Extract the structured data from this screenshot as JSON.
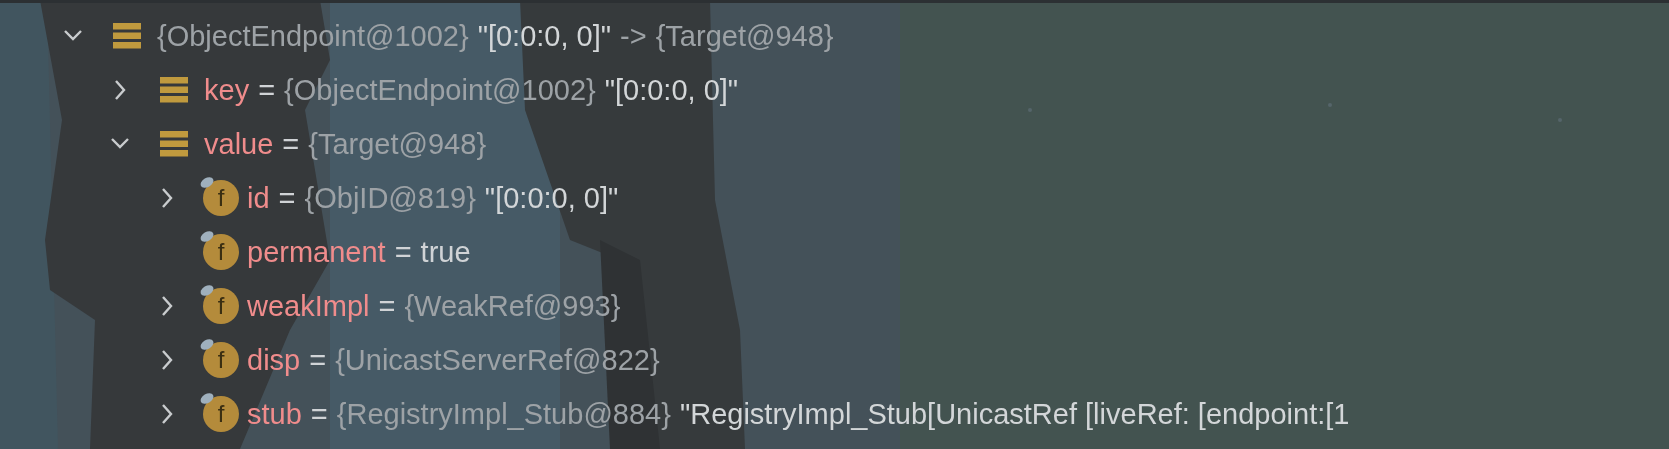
{
  "tree": [
    {
      "kind": "object",
      "expanded": true,
      "type": "{ObjectEndpoint@1002}",
      "value": "\"[0:0:0, 0]\"",
      "arrow": "->",
      "target": "{Target@948}",
      "children": [
        {
          "kind": "object",
          "expanded": false,
          "name": "key",
          "eq": "=",
          "type": "{ObjectEndpoint@1002}",
          "value": "\"[0:0:0, 0]\""
        },
        {
          "kind": "object",
          "expanded": true,
          "name": "value",
          "eq": "=",
          "type": "{Target@948}",
          "children": [
            {
              "kind": "field",
              "badge": "f",
              "expanded": false,
              "name": "id",
              "eq": "=",
              "type": "{ObjID@819}",
              "value": "\"[0:0:0, 0]\""
            },
            {
              "kind": "field",
              "badge": "f",
              "leaf": true,
              "name": "permanent",
              "eq": "=",
              "value": "true"
            },
            {
              "kind": "field",
              "badge": "f",
              "expanded": false,
              "name": "weakImpl",
              "eq": "=",
              "type": "{WeakRef@993}"
            },
            {
              "kind": "field",
              "badge": "f",
              "expanded": false,
              "name": "disp",
              "eq": "=",
              "type": "{UnicastServerRef@822}"
            },
            {
              "kind": "field",
              "badge": "f",
              "expanded": false,
              "name": "stub",
              "eq": "=",
              "type": "{RegistryImpl_Stub@884}",
              "value": "\"RegistryImpl_Stub[UnicastRef [liveRef: [endpoint:[1"
            }
          ]
        }
      ]
    }
  ]
}
